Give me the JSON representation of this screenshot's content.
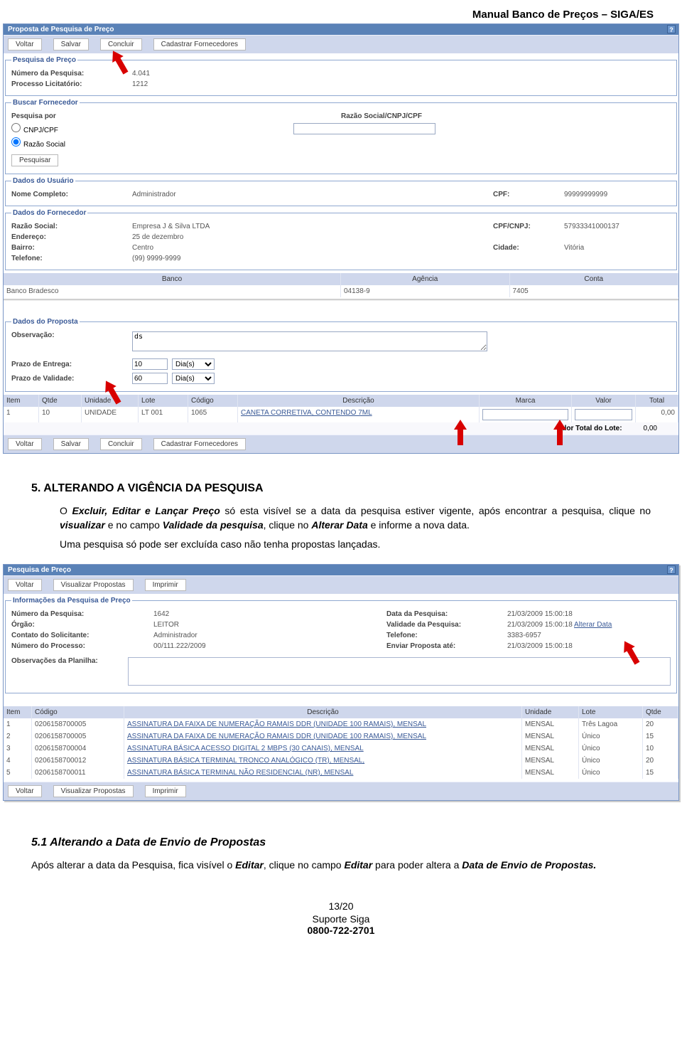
{
  "doc_title": "Manual Banco de Preços – SIGA/ES",
  "shot1": {
    "panel_title": "Proposta de Pesquisa de Preço",
    "toolbar": {
      "voltar": "Voltar",
      "salvar": "Salvar",
      "concluir": "Concluir",
      "cadastrar": "Cadastrar Fornecedores"
    },
    "pesquisa": {
      "legend": "Pesquisa de Preço",
      "num_label": "Número da Pesquisa:",
      "num_value": "4.041",
      "proc_label": "Processo Licitatório:",
      "proc_value": "1212"
    },
    "buscar": {
      "legend": "Buscar Fornecedor",
      "pesq_por_label": "Pesquisa por",
      "opt_cnpj": "CNPJ/CPF",
      "opt_razao": "Razão Social",
      "rsoc_label": "Razão Social/CNPJ/CPF",
      "pesquisar_btn": "Pesquisar"
    },
    "usuario": {
      "legend": "Dados do Usuário",
      "nome_label": "Nome Completo:",
      "nome_value": "Administrador",
      "cpf_label": "CPF:",
      "cpf_value": "99999999999"
    },
    "fornecedor": {
      "legend": "Dados do Fornecedor",
      "razao_label": "Razão Social:",
      "razao_value": "Empresa J & Silva LTDA",
      "cpf_label": "CPF/CNPJ:",
      "cpf_value": "57933341000137",
      "end_label": "Endereço:",
      "end_value": "25 de dezembro",
      "bairro_label": "Bairro:",
      "bairro_value": "Centro",
      "cidade_label": "Cidade:",
      "cidade_value": "Vitória",
      "tel_label": "Telefone:",
      "tel_value": "(99) 9999-9999"
    },
    "banco_head": {
      "banco": "Banco",
      "agencia": "Agência",
      "conta": "Conta"
    },
    "banco_row": {
      "banco": "Banco Bradesco",
      "agencia": "04138-9",
      "conta": "7405"
    },
    "proposta": {
      "legend": "Dados do Proposta",
      "obs_label": "Observação:",
      "obs_value": "ds",
      "prazo_ent_label": "Prazo de Entrega:",
      "prazo_ent_value": "10",
      "prazo_ent_unit": "Dia(s)",
      "prazo_val_label": "Prazo de Validade:",
      "prazo_val_value": "60",
      "prazo_val_unit": "Dia(s)"
    },
    "grid_head": {
      "item": "Item",
      "qtde": "Qtde",
      "unidade": "Unidade",
      "lote": "Lote",
      "codigo": "Código",
      "desc": "Descrição",
      "marca": "Marca",
      "valor": "Valor",
      "total": "Total"
    },
    "grid_row": {
      "item": "1",
      "qtde": "10",
      "unidade": "UNIDADE",
      "lote": "LT 001",
      "codigo": "1065",
      "desc": "CANETA CORRETIVA, CONTENDO 7ML",
      "marca": "",
      "valor": "",
      "total": "0,00"
    },
    "grid_footer_label": "Valor Total do Lote:",
    "grid_footer_value": "0,00"
  },
  "section5_title": "5.    ALTERANDO A VIGÊNCIA DA PESQUISA",
  "section5_para1_a": "O ",
  "section5_para1_b": "Excluir, Editar e Lançar Preço",
  "section5_para1_c": " só esta visível se a data da pesquisa estiver vigente, após encontrar a pesquisa, clique no ",
  "section5_para1_d": "visualizar",
  "section5_para1_e": " e no campo ",
  "section5_para1_f": "Validade da pesquisa",
  "section5_para1_g": ", clique no ",
  "section5_para1_h": "Alterar Data",
  "section5_para1_i": " e informe a nova data.",
  "section5_para2": "Uma pesquisa só pode ser excluída caso não tenha propostas lançadas.",
  "shot2": {
    "panel_title": "Pesquisa de Preço",
    "toolbar": {
      "voltar": "Voltar",
      "visualizar": "Visualizar Propostas",
      "imprimir": "Imprimir"
    },
    "info": {
      "legend": "Informações da Pesquisa de Preço",
      "num_label": "Número da Pesquisa:",
      "num_value": "1642",
      "data_label": "Data da Pesquisa:",
      "data_value": "21/03/2009 15:00:18",
      "orgao_label": "Órgão:",
      "orgao_value": "LEITOR",
      "vali_label": "Validade da Pesquisa:",
      "vali_value": "21/03/2009 15:00:18",
      "vali_link": "Alterar Data",
      "contato_label": "Contato do Solicitante:",
      "contato_value": "Administrador",
      "tel_label": "Telefone:",
      "tel_value": "3383-6957",
      "nproc_label": "Número do Processo:",
      "nproc_value": "00/111.222/2009",
      "enviar_label": "Enviar Proposta até:",
      "enviar_value": "21/03/2009 15:00:18",
      "obs_label": "Observações da Planilha:"
    },
    "grid_head": {
      "item": "Item",
      "codigo": "Código",
      "desc": "Descrição",
      "unidade": "Unidade",
      "lote": "Lote",
      "qtde": "Qtde"
    },
    "rows": [
      {
        "item": "1",
        "codigo": "0206158700005",
        "desc": "ASSINATURA DA FAIXA DE NUMERAÇÃO RAMAIS DDR (UNIDADE 100 RAMAIS), MENSAL",
        "unidade": "MENSAL",
        "lote": "Três Lagoa",
        "qtde": "20"
      },
      {
        "item": "2",
        "codigo": "0206158700005",
        "desc": "ASSINATURA DA FAIXA DE NUMERAÇÃO RAMAIS DDR (UNIDADE 100 RAMAIS), MENSAL",
        "unidade": "MENSAL",
        "lote": "Único",
        "qtde": "15"
      },
      {
        "item": "3",
        "codigo": "0206158700004",
        "desc": "ASSINATURA BÁSICA ACESSO DIGITAL 2 MBPS (30 CANAIS), MENSAL",
        "unidade": "MENSAL",
        "lote": "Único",
        "qtde": "10"
      },
      {
        "item": "4",
        "codigo": "0206158700012",
        "desc": "ASSINATURA BÁSICA TERMINAL TRONCO ANALÓGICO (TR), MENSAL,",
        "unidade": "MENSAL",
        "lote": "Único",
        "qtde": "20"
      },
      {
        "item": "5",
        "codigo": "0206158700011",
        "desc": "ASSINATURA BÁSICA TERMINAL NÃO RESIDENCIAL (NR), MENSAL",
        "unidade": "MENSAL",
        "lote": "Único",
        "qtde": "15"
      }
    ]
  },
  "section51_title": "5.1     Alterando a Data de Envio de Propostas",
  "section51_para_a": "Após alterar a data da Pesquisa, fica visível o ",
  "section51_para_b": "Editar",
  "section51_para_c": ", clique no campo ",
  "section51_para_d": "Editar",
  "section51_para_e": " para poder altera a ",
  "section51_para_f": "Data de Envio de Propostas.",
  "footer": {
    "page": "13/20",
    "line1": "Suporte Siga",
    "line2": "0800-722-2701"
  }
}
